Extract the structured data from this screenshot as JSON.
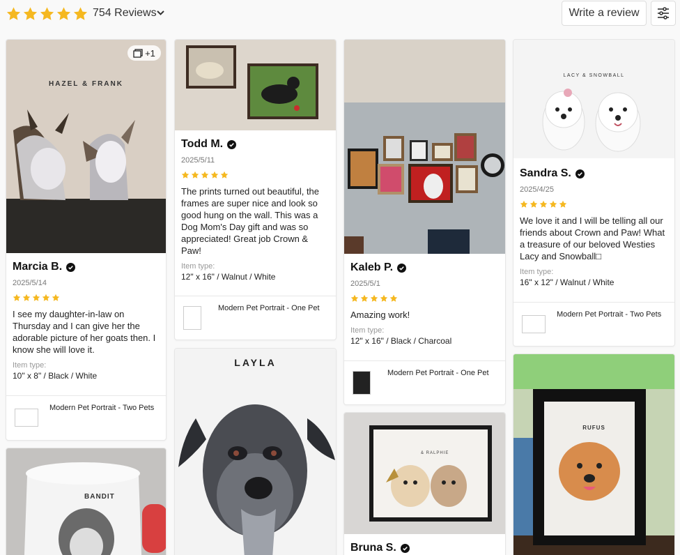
{
  "header": {
    "rating_stars": 5,
    "review_count_label": "754 Reviews",
    "write_review_label": "Write a review",
    "star_color": "#f5b820"
  },
  "reviews": [
    {
      "name": "Marcia B.",
      "date": "2025/5/14",
      "stars": 5,
      "text": "I see my daughter-in-law on Thursday and I can give her the adorable picture of her goats then. I know she will love it.",
      "item_type_label": "Item type:",
      "item_type": "10\" x 8\" / Black / White",
      "product": "Modern Pet Portrait - Two Pets",
      "photo_caption": "HAZEL & FRANK",
      "more_photos": "+1"
    },
    {
      "name": "Todd M.",
      "date": "2025/5/11",
      "stars": 5,
      "text": "The prints turned out beautiful, the frames are super nice and look so good hung on the wall.  This was a Dog Mom's Day gift and was so appreciated!  Great job Crown & Paw!",
      "item_type_label": "Item type:",
      "item_type": "12\" x 16\" / Walnut / White",
      "product": "Modern Pet Portrait - One Pet"
    },
    {
      "name": "Kaleb P.",
      "date": "2025/5/1",
      "stars": 5,
      "text": "Amazing work!",
      "item_type_label": "Item type:",
      "item_type": "12\" x 16\" / Black / Charcoal",
      "product": "Modern Pet Portrait - One Pet"
    },
    {
      "name": "Sandra S.",
      "date": "2025/4/25",
      "stars": 5,
      "text": "We love it and I will be telling all our friends about Crown and Paw! What a treasure of our beloved Westies Lacy and Snowball□",
      "item_type_label": "Item type:",
      "item_type": "16\" x 12\" / Walnut / White",
      "product": "Modern Pet Portrait - Two Pets",
      "photo_caption": "LACY & SNOWBALL"
    },
    {
      "photo_caption": "LAYLA"
    },
    {
      "name": "Bruna S.",
      "photo_caption": "& RALPHIE"
    },
    {
      "photo_caption": "BANDIT"
    },
    {
      "photo_caption": "RUFUS"
    }
  ]
}
